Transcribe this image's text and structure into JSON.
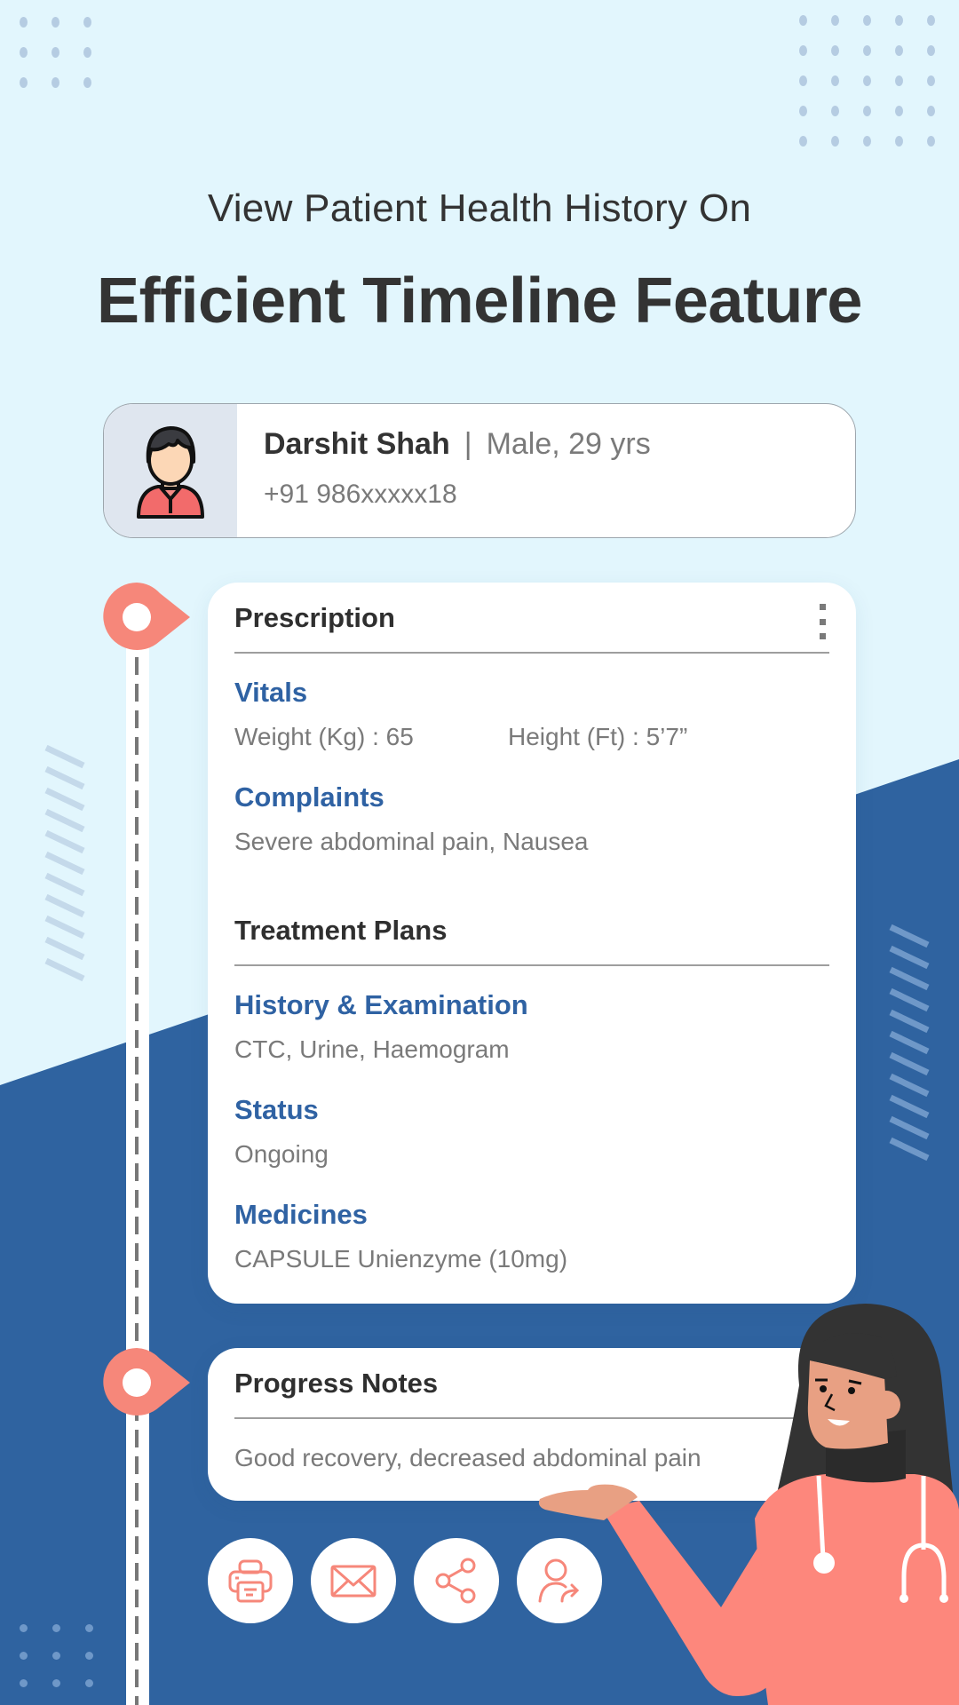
{
  "header": {
    "subtitle": "View Patient Health History On",
    "title": "Efficient Timeline Feature"
  },
  "patient": {
    "avatar_icon": "male-user-avatar-icon",
    "name": "Darshit Shah",
    "separator": "|",
    "meta": "Male, 29 yrs",
    "phone": "+91 986xxxxx18"
  },
  "prescription_card": {
    "title": "Prescription",
    "menu_icon": "kebab-menu-icon",
    "vitals": {
      "label": "Vitals",
      "weight": "Weight (Kg)  :  65",
      "height": "Height (Ft)  :  5’7”"
    },
    "complaints": {
      "label": "Complaints",
      "value": "Severe abdominal pain, Nausea"
    },
    "treatment_plans": {
      "title": "Treatment Plans",
      "history": {
        "label": "History & Examination",
        "value": "CTC, Urine, Haemogram"
      },
      "status": {
        "label": "Status",
        "value": "Ongoing"
      },
      "medicines": {
        "label": "Medicines",
        "value": "CAPSULE Unienzyme (10mg)"
      }
    }
  },
  "progress_card": {
    "title": "Progress Notes",
    "value": "Good recovery, decreased abdominal pain"
  },
  "actions": [
    {
      "icon": "printer-icon",
      "label": "Print"
    },
    {
      "icon": "mail-icon",
      "label": "Email"
    },
    {
      "icon": "share-icon",
      "label": "Share"
    },
    {
      "icon": "refer-user-icon",
      "label": "Refer"
    }
  ],
  "colors": {
    "background_light": "#e2f6fd",
    "background_blue": "#2f63a0",
    "accent_coral": "#f6877a",
    "heading_blue": "#2f62a3",
    "text_dark": "#333333",
    "text_muted": "#7a7a7a"
  }
}
